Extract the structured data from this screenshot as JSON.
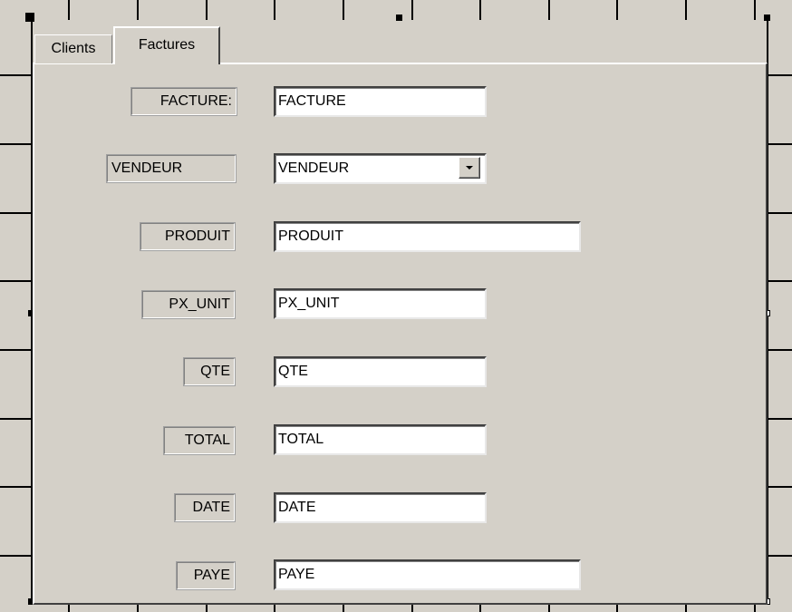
{
  "tabs": [
    {
      "label": "Clients",
      "active": false
    },
    {
      "label": "Factures",
      "active": true
    }
  ],
  "form": {
    "facture": {
      "label": "FACTURE:",
      "value": "FACTURE"
    },
    "vendeur": {
      "label": "VENDEUR",
      "value": "VENDEUR"
    },
    "produit": {
      "label": "PRODUIT",
      "value": "PRODUIT"
    },
    "px_unit": {
      "label": "PX_UNIT",
      "value": "PX_UNIT"
    },
    "qte": {
      "label": "QTE",
      "value": "QTE"
    },
    "total": {
      "label": "TOTAL",
      "value": "TOTAL"
    },
    "date": {
      "label": "DATE",
      "value": "DATE"
    },
    "paye": {
      "label": "PAYE",
      "value": "PAYE"
    }
  },
  "colors": {
    "background": "#d4d0c8",
    "field_background": "#ffffff"
  },
  "icons": {
    "combo_dropdown": "chevron-down-icon"
  }
}
